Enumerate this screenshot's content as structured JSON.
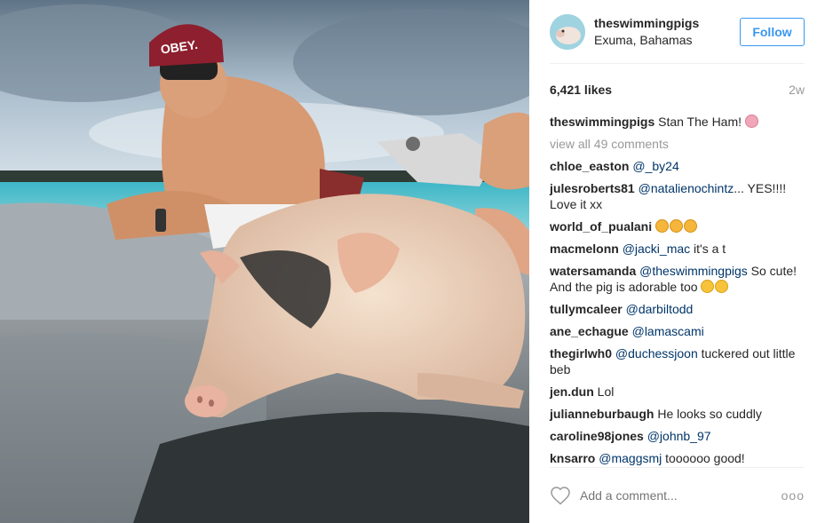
{
  "photo": {
    "cap_text": "OBEY."
  },
  "header": {
    "username": "theswimmingpigs",
    "location": "Exuma, Bahamas",
    "follow_label": "Follow",
    "avatar_icon": "pig-avatar-icon"
  },
  "stats": {
    "likes": "6,421 likes",
    "time": "2w"
  },
  "caption": {
    "user": "theswimmingpigs",
    "text": "Stan The Ham! "
  },
  "view_all": "view all 49 comments",
  "comments": [
    {
      "user": "chloe_easton",
      "mention": "@_by24",
      "text": ""
    },
    {
      "user": "julesroberts81",
      "mention": "@natalienochintz",
      "text": "... YES!!!! Love it xx"
    },
    {
      "user": "world_of_pualani",
      "mention": "",
      "text": ""
    },
    {
      "user": "macmelonn",
      "mention": "@jacki_mac",
      "text": " it's a t"
    },
    {
      "user": "watersamanda",
      "mention": "@theswimmingpigs",
      "text": " So cute! And the pig is adorable too "
    },
    {
      "user": "tullymcaleer",
      "mention": "@darbiltodd",
      "text": ""
    },
    {
      "user": "ane_echague",
      "mention": "@lamascami",
      "text": ""
    },
    {
      "user": "thegirlwh0",
      "mention": "@duchessjoon",
      "text": " tuckered out little beb"
    },
    {
      "user": "jen.dun",
      "mention": "",
      "text": "Lol"
    },
    {
      "user": "julianneburbaugh",
      "mention": "",
      "text": "He looks so cuddly"
    },
    {
      "user": "caroline98jones",
      "mention": "@johnb_97",
      "text": ""
    },
    {
      "user": "knsarro",
      "mention": "@maggsmj",
      "text": " toooooo good!"
    }
  ],
  "footer": {
    "placeholder": "Add a comment...",
    "more": "ooo"
  },
  "colors": {
    "link": "#003569",
    "accent": "#3897f0",
    "muted": "#999999"
  }
}
